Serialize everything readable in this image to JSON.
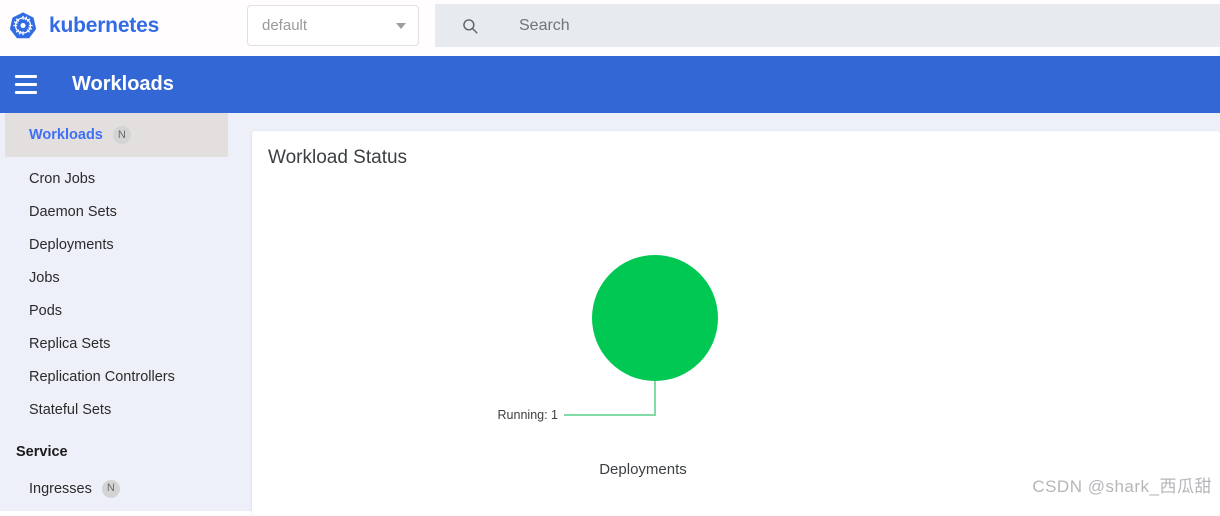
{
  "header": {
    "brand": "kubernetes",
    "logo_icon": "kubernetes-helm-icon",
    "namespace": {
      "value": "default",
      "caret_icon": "chevron-down-icon"
    },
    "search": {
      "icon": "search-icon",
      "placeholder": "Search",
      "value": ""
    }
  },
  "toolbar": {
    "menu_icon": "hamburger-menu-icon",
    "title": "Workloads",
    "background": "#3367d6"
  },
  "sidebar": {
    "background": "#eef0f9",
    "active_background": "#e4dfdf",
    "active_color": "#3f6ff5",
    "items": [
      {
        "label": "Workloads",
        "badge": "N",
        "active": true,
        "type": "group"
      },
      {
        "label": "Cron Jobs",
        "badge": "",
        "active": false,
        "type": "item"
      },
      {
        "label": "Daemon Sets",
        "badge": "",
        "active": false,
        "type": "item"
      },
      {
        "label": "Deployments",
        "badge": "",
        "active": false,
        "type": "item"
      },
      {
        "label": "Jobs",
        "badge": "",
        "active": false,
        "type": "item"
      },
      {
        "label": "Pods",
        "badge": "",
        "active": false,
        "type": "item"
      },
      {
        "label": "Replica Sets",
        "badge": "",
        "active": false,
        "type": "item"
      },
      {
        "label": "Replication Controllers",
        "badge": "",
        "active": false,
        "type": "item"
      },
      {
        "label": "Stateful Sets",
        "badge": "",
        "active": false,
        "type": "item"
      },
      {
        "label": "Service",
        "badge": "",
        "active": false,
        "type": "section"
      },
      {
        "label": "Ingresses",
        "badge": "N",
        "active": false,
        "type": "item"
      }
    ]
  },
  "main": {
    "card_title": "Workload Status"
  },
  "chart_data": {
    "type": "pie",
    "title": "Workload Status",
    "subtitle": "Deployments",
    "categories": [
      "Running"
    ],
    "values": [
      1
    ],
    "labels": [
      "Running: 1"
    ],
    "colors": [
      "#00c853"
    ],
    "leader_line_color": "#80dba5",
    "legend": "none",
    "grid": false
  },
  "watermark": {
    "text": "CSDN @shark_西瓜甜"
  }
}
